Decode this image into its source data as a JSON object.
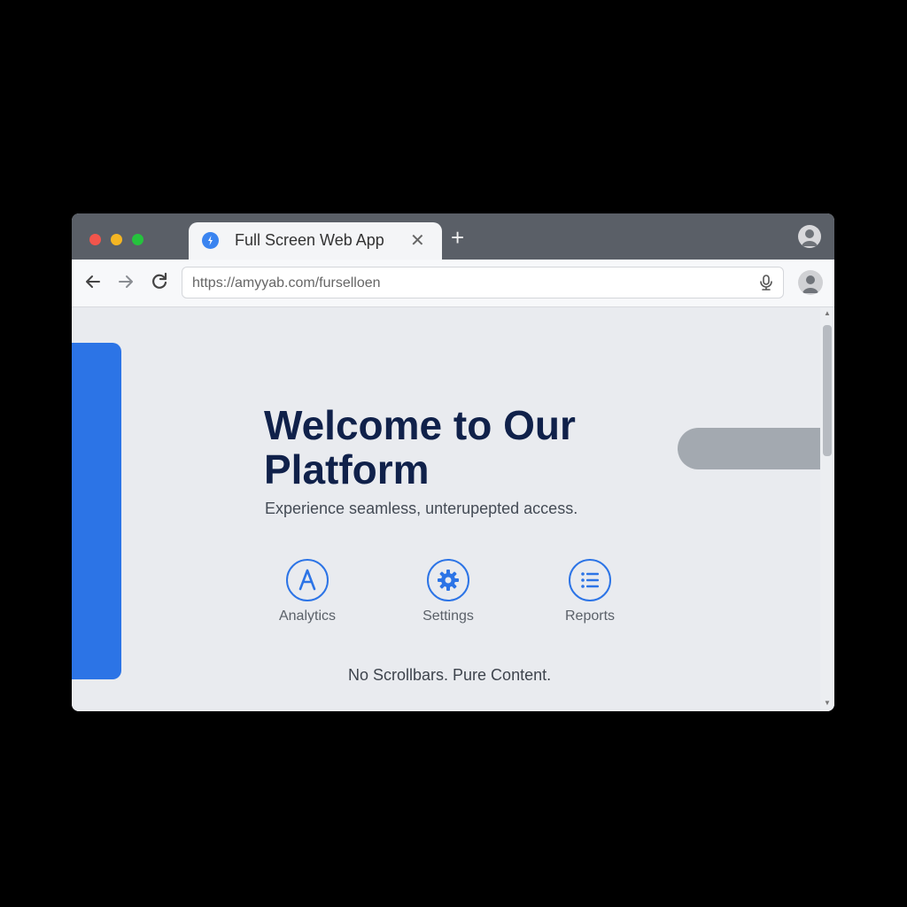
{
  "window": {
    "traffic_colors": [
      "#f2554c",
      "#f5b623",
      "#25c33d"
    ]
  },
  "tab": {
    "title": "Full Screen Web App",
    "favicon_icon": "app-favicon-icon",
    "close_icon": "close-icon"
  },
  "new_tab": {
    "icon": "plus-icon"
  },
  "toolbar": {
    "back_icon": "arrow-left-icon",
    "forward_icon": "arrow-right-icon",
    "reload_icon": "reload-icon",
    "url": "https://amyyab.com/furselloen",
    "mic_icon": "microphone-icon"
  },
  "main": {
    "headline": "Welcome to Our Platform",
    "subtitle": "Experience seamless, unterupepted access.",
    "features": [
      {
        "label": "Analytics",
        "icon": "letter-a-icon"
      },
      {
        "label": "Settings",
        "icon": "gear-icon"
      },
      {
        "label": "Reports",
        "icon": "list-icon"
      }
    ],
    "footer": "No Scrollbars. Pure Content."
  },
  "colors": {
    "accent": "#2c74e6",
    "headline": "#10214a",
    "tabbar": "#5a5f67"
  }
}
